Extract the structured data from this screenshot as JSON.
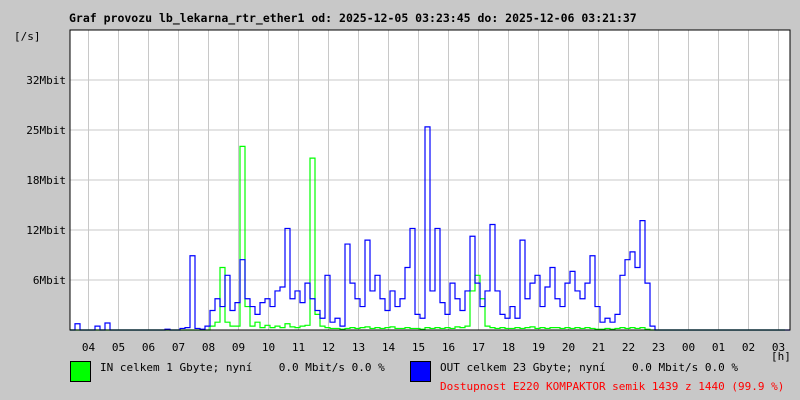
{
  "chart_data": {
    "type": "line",
    "title": "Graf provozu lb_lekarna_rtr_ether1 od: 2025-12-05 03:23:45 do: 2025-12-06 03:21:37",
    "ylabel": "[/s]",
    "xlabel": "[h]",
    "ylim": [
      0,
      38.4
    ],
    "y_unit": "Mbit/s",
    "y_ticks": [
      6.4,
      12.8,
      19.2,
      25.6,
      32
    ],
    "y_tick_labels": [
      "6Mbit",
      "12Mbit",
      "18Mbit",
      "25Mbit",
      "32Mbit"
    ],
    "x_start": "03:23",
    "sample_minutes": 10,
    "x_tick_labels": [
      "04",
      "05",
      "06",
      "07",
      "08",
      "09",
      "10",
      "11",
      "12",
      "13",
      "14",
      "15",
      "16",
      "17",
      "18",
      "19",
      "20",
      "21",
      "22",
      "23",
      "00",
      "01",
      "02",
      "03"
    ],
    "grid": true,
    "series": [
      {
        "name": "IN",
        "color": "#00ff00",
        "values": [
          0,
          0,
          0,
          0,
          0,
          0,
          0,
          0,
          0,
          0,
          0,
          0,
          0,
          0,
          0,
          0,
          0,
          0,
          0,
          0,
          0,
          0,
          0,
          0,
          0,
          0,
          0,
          0,
          0.5,
          1,
          8,
          1,
          0.5,
          0.5,
          23.5,
          3,
          0.5,
          1,
          0.3,
          0.6,
          0.3,
          0.5,
          0.3,
          0.8,
          0.4,
          0.3,
          0.5,
          0.6,
          22,
          2,
          0.5,
          0.3,
          0.2,
          0.2,
          0.1,
          0.2,
          0.3,
          0.2,
          0.3,
          0.4,
          0.2,
          0.3,
          0.2,
          0.3,
          0.4,
          0.2,
          0.2,
          0.3,
          0.2,
          0.2,
          0.1,
          0.3,
          0.2,
          0.3,
          0.2,
          0.3,
          0.2,
          0.4,
          0.3,
          0.5,
          5,
          7,
          4,
          0.5,
          0.3,
          0.2,
          0.3,
          0.2,
          0.2,
          0.3,
          0.2,
          0.3,
          0.4,
          0.2,
          0.3,
          0.2,
          0.3,
          0.3,
          0.2,
          0.3,
          0.2,
          0.3,
          0.2,
          0.3,
          0.2,
          0.1,
          0.1,
          0.2,
          0.1,
          0.2,
          0.3,
          0.2,
          0.3,
          0.2,
          0.3,
          0.1,
          0,
          0,
          0,
          0,
          0,
          0,
          0,
          0,
          0,
          0,
          0,
          0,
          0,
          0,
          0,
          0,
          0,
          0,
          0,
          0,
          0,
          0,
          0,
          0,
          0,
          0,
          0
        ]
      },
      {
        "name": "OUT",
        "color": "#0000ff",
        "values": [
          0,
          0.8,
          0,
          0,
          0,
          0.5,
          0,
          0.9,
          0,
          0,
          0,
          0,
          0,
          0,
          0,
          0,
          0,
          0,
          0,
          0.1,
          0,
          0,
          0.2,
          0.3,
          9.5,
          0.2,
          0.1,
          0.5,
          2.5,
          4,
          3,
          7,
          2.5,
          3.5,
          9,
          4,
          3,
          2,
          3.5,
          4,
          3,
          5,
          5.5,
          13,
          4,
          5,
          3.5,
          6,
          4,
          2.5,
          1.5,
          7,
          1,
          1.5,
          0.5,
          11,
          6,
          4,
          3,
          11.5,
          5,
          7,
          4,
          2.5,
          5,
          3,
          4,
          8,
          13,
          2,
          1.5,
          26,
          5,
          13,
          3.5,
          2,
          6,
          4,
          2.5,
          5,
          12,
          6,
          3,
          5,
          13.5,
          5,
          2,
          1.5,
          3,
          1.5,
          11.5,
          4,
          6,
          7,
          3,
          5.5,
          8,
          4,
          3,
          6,
          7.5,
          5,
          4,
          6,
          9.5,
          3,
          1,
          1.5,
          1,
          2,
          7,
          9,
          10,
          8,
          14,
          6,
          0.5,
          0,
          0,
          0,
          0,
          0,
          0,
          0,
          0,
          0,
          0,
          0,
          0,
          0,
          0,
          0,
          0,
          0,
          0,
          0,
          0,
          0,
          0,
          0,
          0,
          0,
          0,
          0
        ]
      }
    ]
  },
  "legend": {
    "in_text": "IN celkem 1 Gbyte; nyní    0.0 Mbit/s 0.0 %",
    "out_text": "OUT celkem 23 Gbyte; nyní    0.0 Mbit/s 0.0 %",
    "availability": "Dostupnost E220 KOMPAKTOR semik 1439 z 1440 (99.9 %)"
  }
}
